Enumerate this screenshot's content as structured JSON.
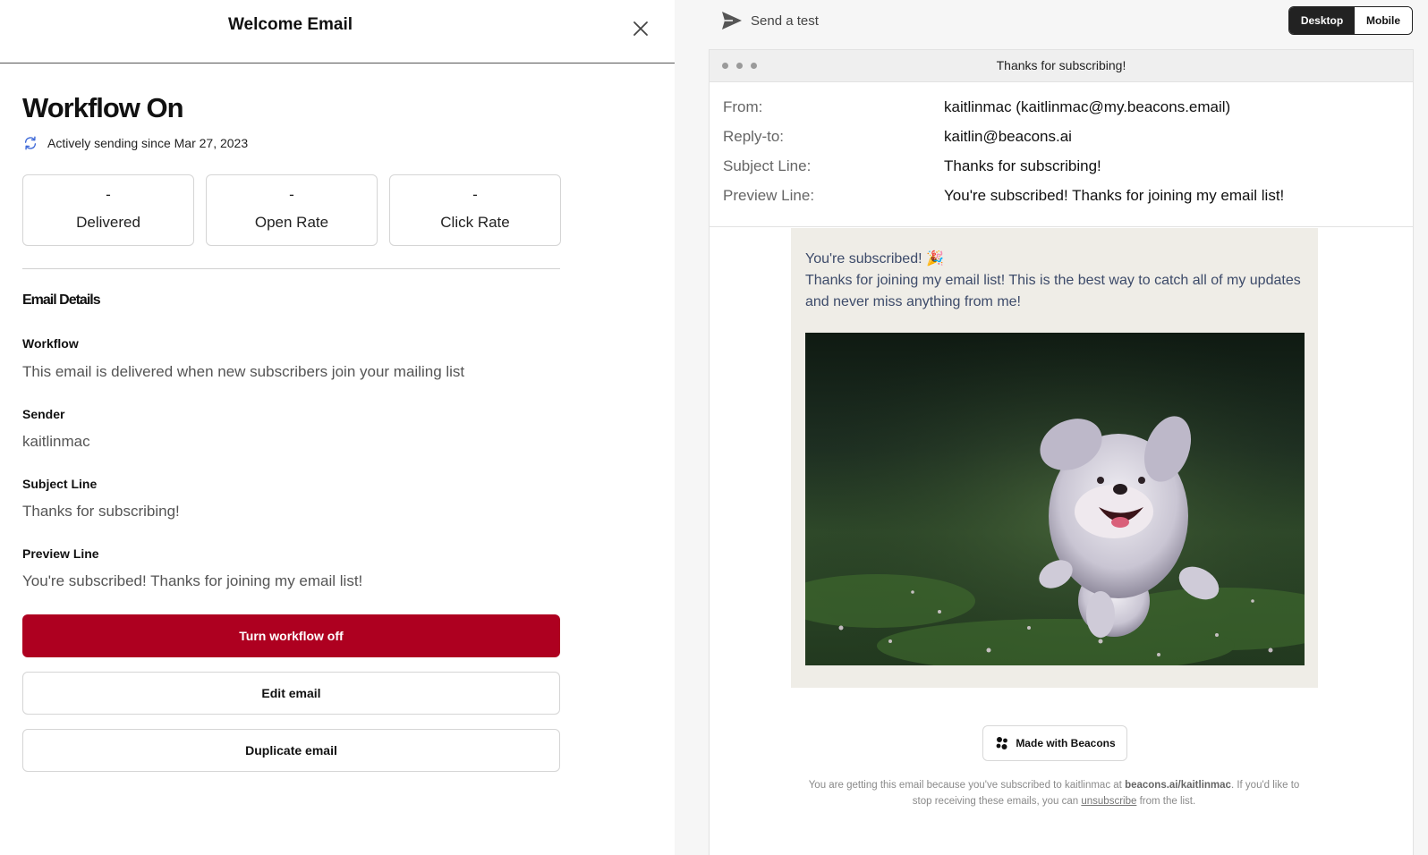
{
  "header": {
    "title": "Welcome Email",
    "close_icon": "close-icon"
  },
  "workflow": {
    "title": "Workflow On",
    "status_text": "Actively sending since Mar 27, 2023",
    "status_icon": "sync-icon"
  },
  "stats": [
    {
      "value": "-",
      "label": "Delivered"
    },
    {
      "value": "-",
      "label": "Open Rate"
    },
    {
      "value": "-",
      "label": "Click Rate"
    }
  ],
  "details": {
    "section_title": "Email Details",
    "fields": [
      {
        "label": "Workflow",
        "value": "This email is delivered when new subscribers join your mailing list"
      },
      {
        "label": "Sender",
        "value": "kaitlinmac"
      },
      {
        "label": "Subject Line",
        "value": "Thanks for subscribing!"
      },
      {
        "label": "Preview Line",
        "value": "You're subscribed! Thanks for joining my email list!"
      }
    ]
  },
  "actions": {
    "turn_off": "Turn workflow off",
    "edit": "Edit email",
    "duplicate": "Duplicate email"
  },
  "preview_toolbar": {
    "send_test": "Send a test",
    "send_icon": "send-icon",
    "view_modes": [
      "Desktop",
      "Mobile"
    ],
    "active_mode": "Desktop"
  },
  "preview": {
    "window_title": "Thanks for subscribing!",
    "meta": [
      {
        "key": "From:",
        "value": "kaitlinmac (kaitlinmac@my.beacons.email)"
      },
      {
        "key": "Reply-to:",
        "value": "kaitlin@beacons.ai"
      },
      {
        "key": "Subject Line:",
        "value": "Thanks for subscribing!"
      },
      {
        "key": "Preview Line:",
        "value": "You're subscribed! Thanks for joining my email list!"
      }
    ],
    "body_line1": "You're subscribed! 🎉",
    "body_line2": "Thanks for joining my email list! This is the best way to catch all of my updates and never miss anything from me!",
    "made_with": "Made with Beacons",
    "footer": {
      "part1": "You are getting this email because you've subscribed to kaitlinmac at ",
      "link1": "beacons.ai/kaitlinmac",
      "part2": ". If you'd like to stop receiving these emails, you can ",
      "link2": "unsubscribe",
      "part3": " from the list."
    }
  },
  "colors": {
    "danger": "#ae0020",
    "email_bg": "#efede7",
    "email_text": "#3d4b6a",
    "accent_sync": "#3f6ad8"
  }
}
